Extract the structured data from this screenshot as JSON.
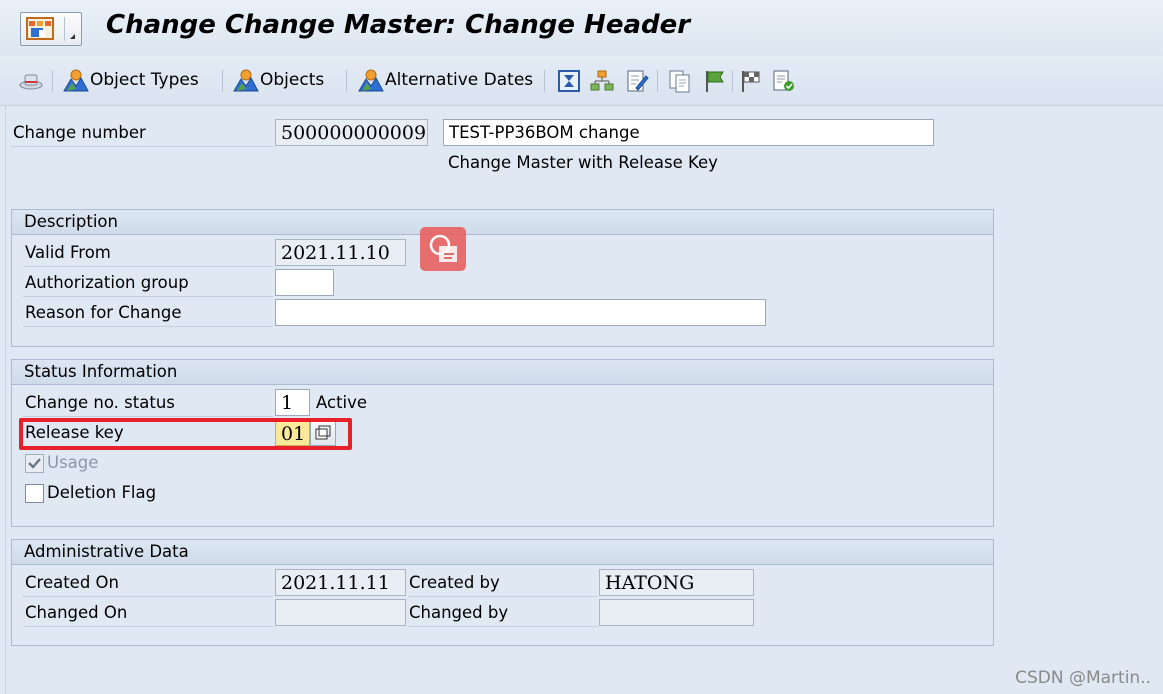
{
  "window": {
    "title": "Change Change Master: Change Header"
  },
  "toolbar": {
    "object_types": "Object Types",
    "objects": "Objects",
    "alternative_dates": "Alternative Dates"
  },
  "header": {
    "change_number_label": "Change number",
    "change_number": "500000000009",
    "description": "TEST-PP36BOM change",
    "subtitle": "Change Master with Release Key"
  },
  "description_group": {
    "title": "Description",
    "valid_from_label": "Valid From",
    "valid_from": "2021.11.10",
    "auth_group_label": "Authorization group",
    "auth_group": "",
    "reason_label": "Reason for Change",
    "reason": ""
  },
  "status_group": {
    "title": "Status Information",
    "status_label": "Change no. status",
    "status": "1",
    "status_text": "Active",
    "release_key_label": "Release key",
    "release_key": "01",
    "usage_label": "Usage",
    "usage_checked": true,
    "deletion_label": "Deletion Flag",
    "deletion_checked": false
  },
  "admin_group": {
    "title": "Administrative Data",
    "created_on_label": "Created On",
    "created_on": "2021.11.11",
    "created_by_label": "Created by",
    "created_by": "HATONG",
    "changed_on_label": "Changed On",
    "changed_on": "",
    "changed_by_label": "Changed by",
    "changed_by": ""
  },
  "watermark": "CSDN @Martin..",
  "colors": {
    "highlight": "#e8202a",
    "release_key_bg": "#fbe99a",
    "background": "#dfe8f3"
  }
}
